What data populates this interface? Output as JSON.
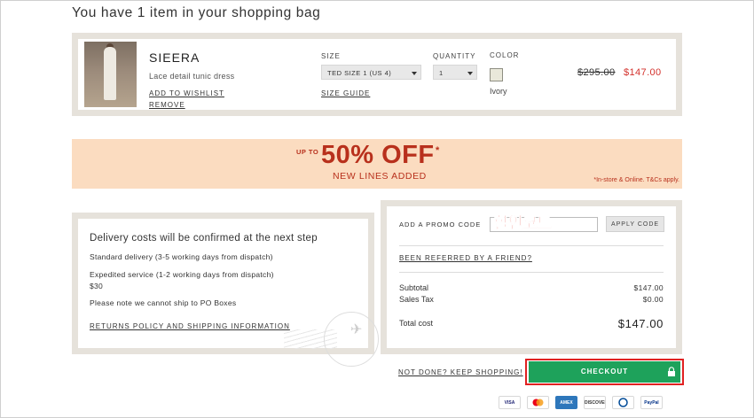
{
  "page": {
    "title": "You have 1 item in your shopping bag"
  },
  "item": {
    "name": "SIEERA",
    "description": "Lace detail tunic dress",
    "add_to_wishlist": "ADD TO WISHLIST",
    "remove": "REMOVE",
    "size_label": "SIZE",
    "size_value": "TED SIZE 1 (US 4)",
    "size_guide": "SIZE GUIDE",
    "quantity_label": "QUANTITY",
    "quantity_value": "1",
    "color_label": "COLOR",
    "color_name": "Ivory",
    "color_hex": "#e9e8da",
    "original_price": "$295.00",
    "sale_price": "$147.00"
  },
  "banner": {
    "up_to": "UP TO",
    "headline": "50% OFF",
    "asterisk": "*",
    "subline": "NEW LINES ADDED",
    "note": "*In-store & Online. T&Cs apply.",
    "background": "#fbdcc0",
    "text_color": "#b8301c"
  },
  "delivery": {
    "title": "Delivery costs will be confirmed at the next step",
    "standard": "Standard delivery (3-5 working days from dispatch)",
    "expedited": "Expedited service (1-2 working days from dispatch)",
    "expedited_price": "$30",
    "po_note": "Please note we cannot ship to PO Boxes",
    "returns_link": "RETURNS POLICY AND SHIPPING INFORMATION"
  },
  "summary": {
    "promo_label": "ADD A PROMO CODE",
    "promo_overlay": "할인코드",
    "promo_value": "",
    "apply_label": "APPLY CODE",
    "referred_link": "BEEN REFERRED BY A FRIEND?",
    "subtotal_label": "Subtotal",
    "subtotal_value": "$147.00",
    "tax_label": "Sales Tax",
    "tax_value": "$0.00",
    "total_label": "Total cost",
    "total_value": "$147.00"
  },
  "actions": {
    "keep_shopping": "NOT DONE? KEEP SHOPPING!",
    "checkout": "CHECKOUT",
    "checkout_color": "#1ea25b"
  },
  "payments": [
    {
      "name": "VISA",
      "icon": "visa-icon",
      "color": "#1a1f71"
    },
    {
      "name": "",
      "icon": "mastercard-icon",
      "color": "#eb001b"
    },
    {
      "name": "AMEX",
      "icon": "amex-icon",
      "color": "#2e77bb"
    },
    {
      "name": "DISCOVER",
      "icon": "discover-icon",
      "color": "#333333"
    },
    {
      "name": "",
      "icon": "diners-icon",
      "color": "#004a97"
    },
    {
      "name": "PayPal",
      "icon": "paypal-icon",
      "color": "#003087"
    }
  ]
}
